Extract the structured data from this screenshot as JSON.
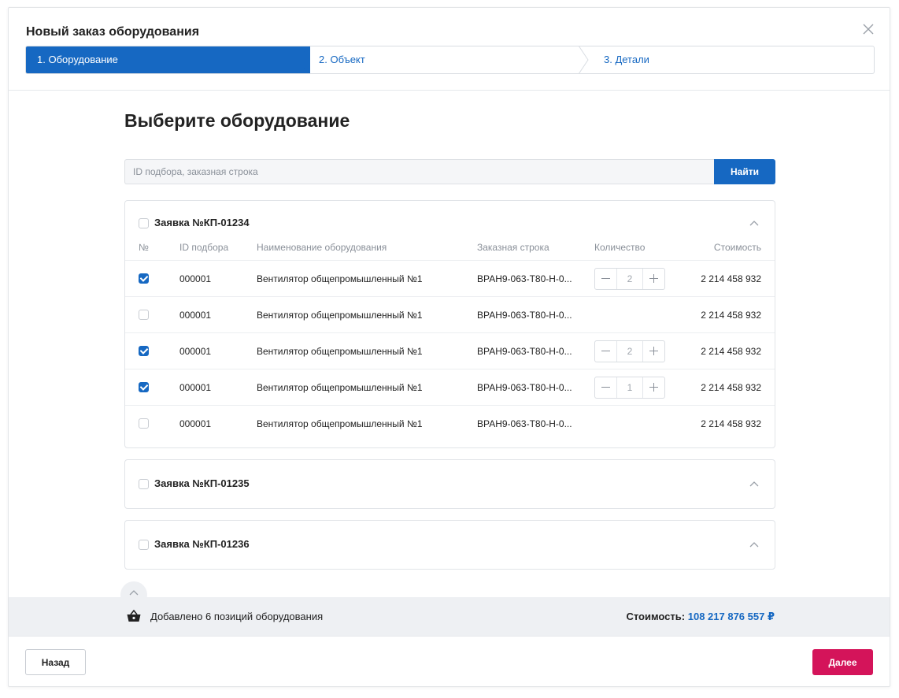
{
  "modal": {
    "title": "Новый заказ оборудования",
    "steps": [
      {
        "label": "1. Оборудование",
        "active": true
      },
      {
        "label": "2. Объект",
        "active": false
      },
      {
        "label": "3. Детали",
        "active": false
      }
    ]
  },
  "main": {
    "section_title": "Выберите оборудование",
    "search": {
      "placeholder": "ID подбора, заказная строка",
      "value": "",
      "button_label": "Найти"
    }
  },
  "table_headers": {
    "num": "№",
    "id": "ID подбора",
    "name": "Наименование оборудования",
    "line": "Заказная строка",
    "qty": "Количество",
    "cost": "Стоимость"
  },
  "orders": [
    {
      "title": "Заявка №КП-01234",
      "checked": false,
      "expanded": true,
      "rows": [
        {
          "checked": true,
          "id": "000001",
          "name": "Вентилятор общепромышленный №1",
          "line": "ВРАН9-063-Т80-Н-0...",
          "qty": "2",
          "cost": "2 214 458 932"
        },
        {
          "checked": false,
          "id": "000001",
          "name": "Вентилятор общепромышленный №1",
          "line": "ВРАН9-063-Т80-Н-0...",
          "qty": null,
          "cost": "2 214 458 932"
        },
        {
          "checked": true,
          "id": "000001",
          "name": "Вентилятор общепромышленный №1",
          "line": "ВРАН9-063-Т80-Н-0...",
          "qty": "2",
          "cost": "2 214 458 932"
        },
        {
          "checked": true,
          "id": "000001",
          "name": "Вентилятор общепромышленный №1",
          "line": "ВРАН9-063-Т80-Н-0...",
          "qty": "1",
          "cost": "2 214 458 932"
        },
        {
          "checked": false,
          "id": "000001",
          "name": "Вентилятор общепромышленный №1",
          "line": "ВРАН9-063-Т80-Н-0...",
          "qty": null,
          "cost": "2 214 458 932"
        }
      ]
    },
    {
      "title": "Заявка №КП-01235",
      "checked": false,
      "expanded": false,
      "rows": []
    },
    {
      "title": "Заявка №КП-01236",
      "checked": false,
      "expanded": false,
      "rows": []
    }
  ],
  "summary": {
    "added_text": "Добавлено 6 позиций оборудования",
    "cost_label": "Стоимость:",
    "cost_value": "108 217 876 557 ₽"
  },
  "footer": {
    "back_label": "Назад",
    "next_label": "Далее"
  },
  "colors": {
    "accent": "#1668c2",
    "primary_action": "#d4145a",
    "summary_bg": "#eef0f3"
  },
  "icons": {
    "close": "close-icon",
    "chevron": "chevron-up-icon",
    "basket": "basket-icon"
  }
}
